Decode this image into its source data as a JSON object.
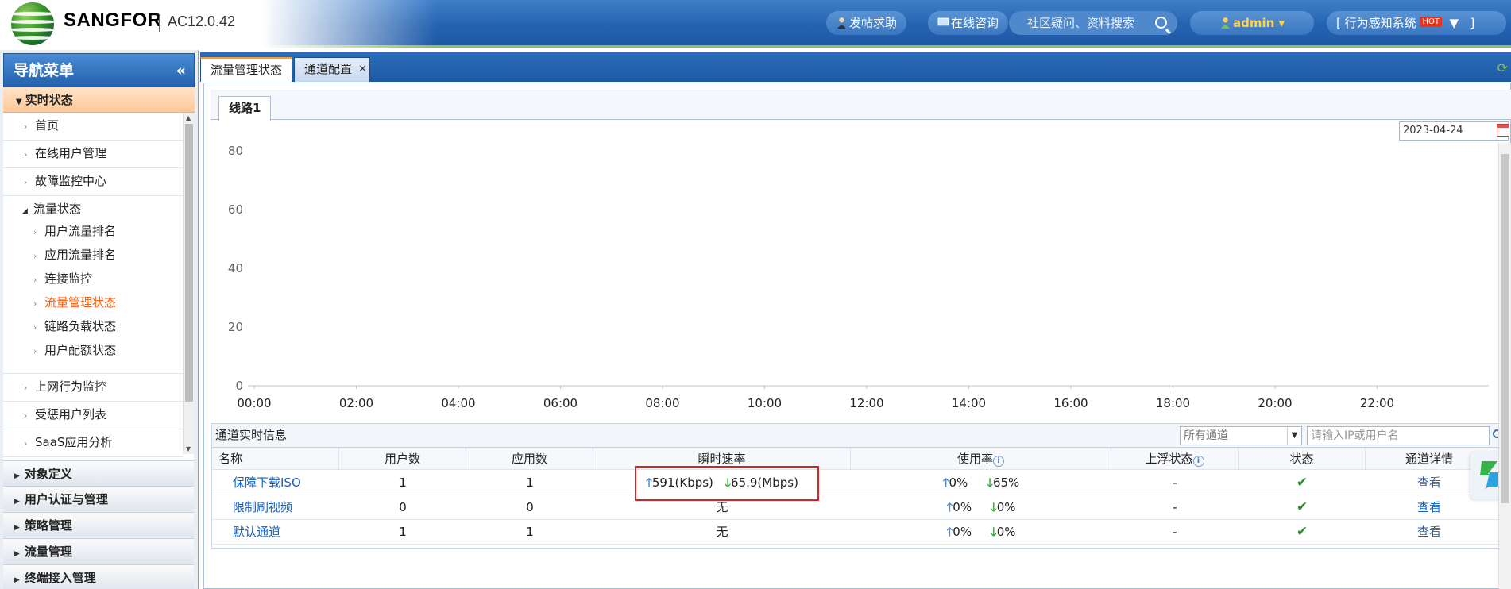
{
  "header": {
    "brand": "SANGFOR",
    "version": "AC12.0.42",
    "help_label": "发帖求助",
    "consult_label": "在线咨询",
    "search_placeholder": "社区疑问、资料搜索",
    "user": "admin",
    "system_label": "行为感知系统",
    "hot_badge": "HOT",
    "system_prefix": "[",
    "system_suffix": "]"
  },
  "sidebar": {
    "title": "导航菜单",
    "collapse": "«",
    "section": "实时状态",
    "items": [
      {
        "label": "首页"
      },
      {
        "label": "在线用户管理"
      },
      {
        "label": "故障监控中心"
      },
      {
        "label": "流量状态"
      },
      {
        "label": "用户流量排名"
      },
      {
        "label": "应用流量排名"
      },
      {
        "label": "连接监控"
      },
      {
        "label": "流量管理状态"
      },
      {
        "label": "链路负载状态"
      },
      {
        "label": "用户配额状态"
      },
      {
        "label": "上网行为监控"
      },
      {
        "label": "受惩用户列表"
      },
      {
        "label": "SaaS应用分析"
      }
    ],
    "bottom_sections": [
      "对象定义",
      "用户认证与管理",
      "策略管理",
      "流量管理",
      "终端接入管理"
    ]
  },
  "tabs": [
    {
      "label": "流量管理状态"
    },
    {
      "label": "通道配置"
    }
  ],
  "subtab": "线路1",
  "date": "2023-04-24",
  "chart_data": {
    "type": "line",
    "x": [
      "00:00",
      "02:00",
      "04:00",
      "06:00",
      "08:00",
      "10:00",
      "12:00",
      "14:00",
      "16:00",
      "18:00",
      "20:00",
      "22:00"
    ],
    "y_ticks": [
      0,
      20,
      40,
      60,
      80
    ],
    "ylim": [
      0,
      80
    ],
    "grid": false,
    "title": "",
    "xlabel": "",
    "ylabel": ""
  },
  "realtime": {
    "title": "通道实时信息",
    "filter_value": "所有通道",
    "search_placeholder": "请输入IP或用户名",
    "columns": [
      "名称",
      "用户数",
      "应用数",
      "瞬时速率",
      "使用率",
      "上浮状态",
      "状态",
      "通道详情"
    ],
    "rows": [
      {
        "name": "保障下载ISO",
        "users": "1",
        "apps": "1",
        "up_rate": "591(Kbps)",
        "down_rate": "65.9(Mbps)",
        "rate_text": "",
        "up_usage": "0%",
        "down_usage": "65%",
        "float": "-",
        "detail": "查看"
      },
      {
        "name": "限制刷视频",
        "users": "0",
        "apps": "0",
        "up_rate": "",
        "down_rate": "",
        "rate_text": "无",
        "up_usage": "0%",
        "down_usage": "0%",
        "float": "-",
        "detail": "查看"
      },
      {
        "name": "默认通道",
        "users": "1",
        "apps": "1",
        "up_rate": "",
        "down_rate": "",
        "rate_text": "无",
        "up_usage": "0%",
        "down_usage": "0%",
        "float": "-",
        "detail": "查看"
      }
    ]
  },
  "colors": {
    "header_blue": "#2563b2",
    "accent_orange": "#ff5a00",
    "highlight_red": "#e02020",
    "up_blue": "#4a90d9",
    "down_green": "#3caa3c"
  }
}
